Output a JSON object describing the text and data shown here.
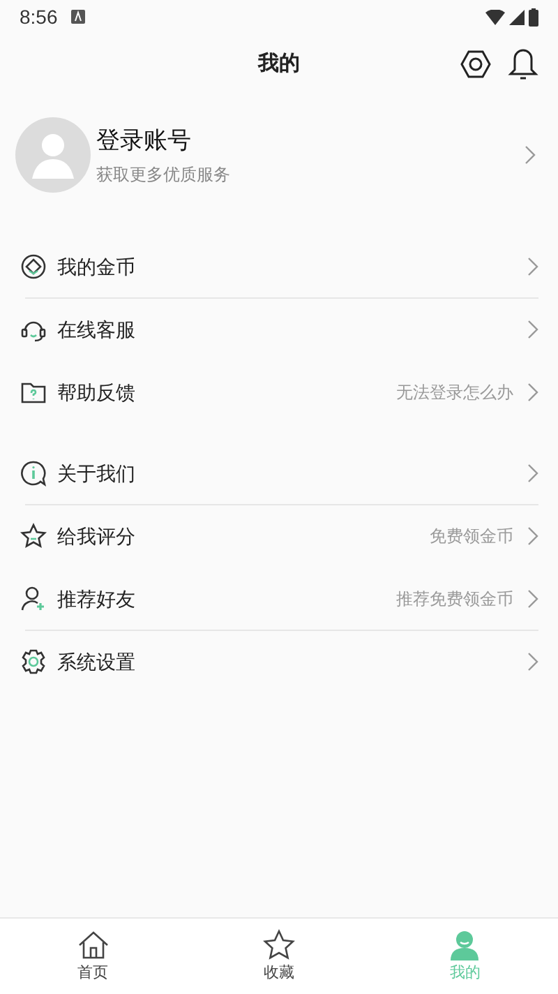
{
  "status_bar": {
    "time": "8:56"
  },
  "header": {
    "title": "我的"
  },
  "profile": {
    "name": "登录账号",
    "subtitle": "获取更多优质服务"
  },
  "groups": [
    {
      "items": [
        {
          "kind": "coin",
          "label": "我的金币",
          "divider": true
        },
        {
          "kind": "headset",
          "label": "在线客服",
          "divider": false
        },
        {
          "kind": "folder",
          "label": "帮助反馈",
          "hint": "无法登录怎么办",
          "divider": false
        }
      ]
    },
    {
      "items": [
        {
          "kind": "info",
          "label": "关于我们",
          "divider": true
        },
        {
          "kind": "star",
          "label": "给我评分",
          "hint": "免费领金币",
          "divider": false
        },
        {
          "kind": "user",
          "label": "推荐好友",
          "hint": "推荐免费领金币",
          "divider": true
        },
        {
          "kind": "gear",
          "label": "系统设置",
          "divider": false
        }
      ]
    }
  ],
  "tab_bar": [
    {
      "kind": "home",
      "label": "首页",
      "selected": false
    },
    {
      "kind": "star",
      "label": "收藏",
      "selected": false
    },
    {
      "kind": "person",
      "label": "我的",
      "selected": true
    }
  ]
}
